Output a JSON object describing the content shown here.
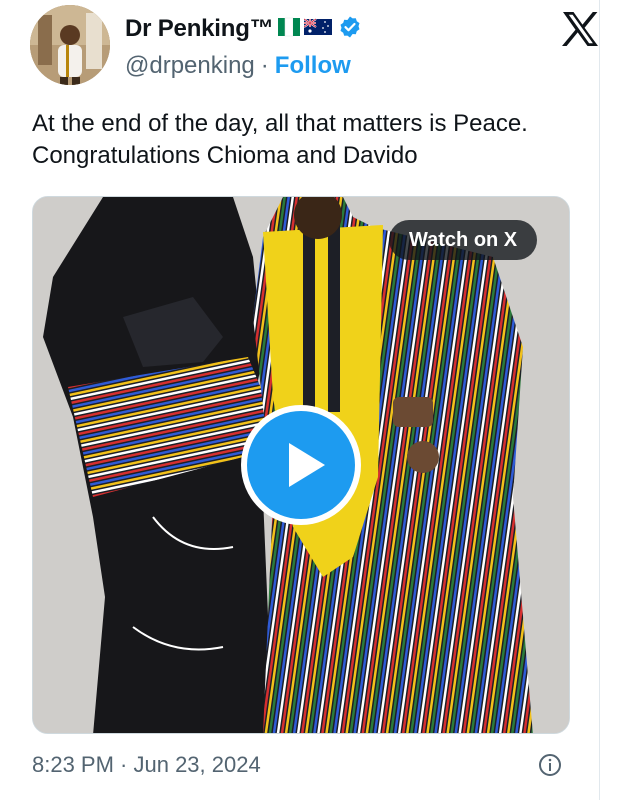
{
  "tweet": {
    "author": {
      "display_name": "Dr Penking™",
      "handle": "@drpenking",
      "verified": true,
      "flags": [
        "nigeria-flag-icon",
        "australia-flag-icon"
      ]
    },
    "separator": "·",
    "follow_label": "Follow",
    "brand_icon": "x-logo-icon",
    "text_lines": [
      "At the end of the day, all that matters is Peace.",
      "Congratulations Chioma and Davido"
    ],
    "media": {
      "watch_label": "Watch on X",
      "play_icon": "play-icon"
    },
    "timestamp": "8:23 PM · Jun 23, 2024",
    "info_icon": "info-icon"
  },
  "colors": {
    "accent": "#1d9bf0",
    "text_primary": "#0f1419",
    "text_secondary": "#536471",
    "border": "#cfd9de",
    "verified": "#1d9bf0"
  }
}
